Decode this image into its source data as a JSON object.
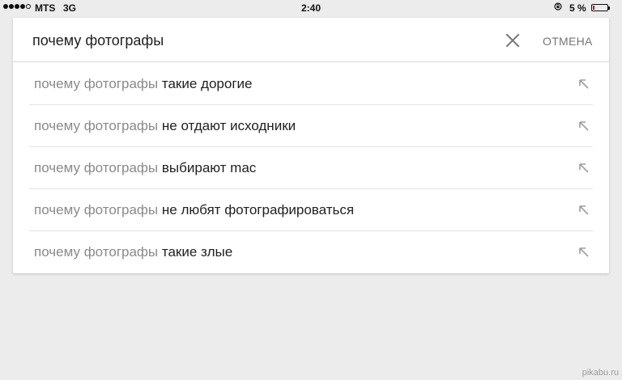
{
  "status_bar": {
    "carrier": "MTS",
    "network": "3G",
    "time": "2:40",
    "battery_percent_label": "5 %",
    "battery_level": 0.05,
    "battery_color": "#d00000",
    "signal_bars_filled": 4,
    "signal_bars_total": 5,
    "icons": [
      "signal-dots-icon",
      "rotation-lock-icon",
      "battery-icon"
    ]
  },
  "search": {
    "query": "почему фотографы",
    "clear_icon": "close-icon",
    "cancel_label": "ОТМЕНА"
  },
  "suggestions": [
    {
      "prefix": "почему фотографы",
      "completion": "такие дорогие"
    },
    {
      "prefix": "почему фотографы",
      "completion": "не отдают исходники"
    },
    {
      "prefix": "почему фотографы",
      "completion": "выбирают mac"
    },
    {
      "prefix": "почему фотографы",
      "completion": "не любят фотографироваться"
    },
    {
      "prefix": "почему фотографы",
      "completion": "такие злые"
    }
  ],
  "suggestion_icon": "arrow-up-left-icon",
  "watermark": "pikabu.ru",
  "colors": {
    "background": "#ececec",
    "card": "#ffffff",
    "prefix_text": "#8a8a8a",
    "completion_text": "#212121",
    "cancel_text": "#757575"
  }
}
